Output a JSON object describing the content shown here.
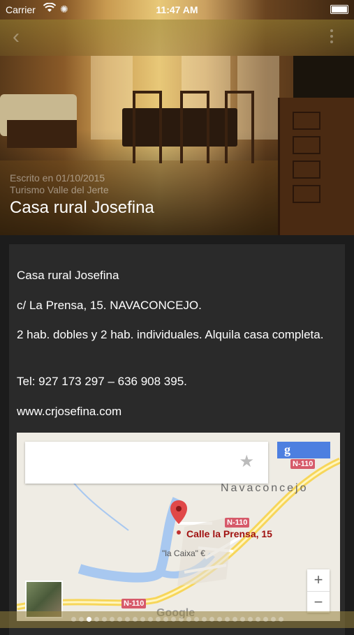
{
  "status_bar": {
    "carrier": "Carrier",
    "time": "11:47 AM"
  },
  "nav": {
    "back_icon": "chevron-left-icon",
    "menu_icon": "more-vertical-icon"
  },
  "hero": {
    "date_line": "Escrito en 01/10/2015",
    "category": "Turismo Valle del Jerte",
    "title": "Casa rural Josefina"
  },
  "content": {
    "name": "Casa rural Josefina",
    "address": "c/ La Prensa, 15. NAVACONCEJO.",
    "rooms": "2 hab. dobles y 2 hab. individuales. Alquila casa completa.",
    "phone": "Tel: 927 173 297 – 636 908 395.",
    "website": "www.crjosefina.com"
  },
  "map": {
    "search_placeholder": "",
    "google_button": "g",
    "town_label": "Navaconcejo",
    "road_labels": [
      "N-110",
      "N-110",
      "N-110"
    ],
    "pin_label": "Calle la Prensa, 15",
    "poi_label": "\"la Caixa\" €",
    "zoom_in": "+",
    "zoom_out": "−",
    "attribution": "Google"
  },
  "pager": {
    "total": 28,
    "current": 2
  }
}
